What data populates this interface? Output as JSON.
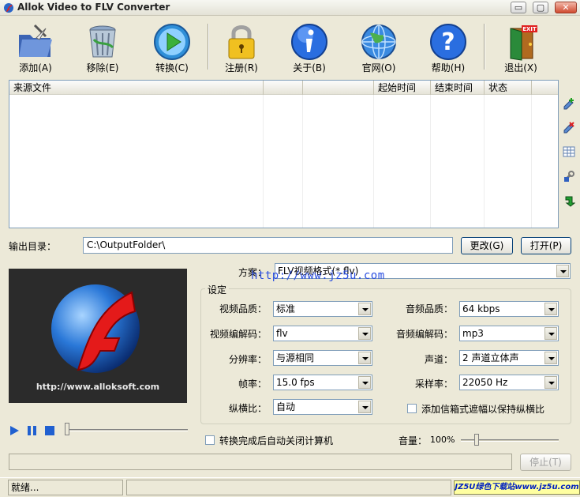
{
  "window": {
    "title": "Allok Video to FLV Converter",
    "min": "▭",
    "max": "▢",
    "close": "✕"
  },
  "toolbar": [
    {
      "label": "添加(A)",
      "icon": "folder-add-icon"
    },
    {
      "label": "移除(E)",
      "icon": "trash-bin-icon"
    },
    {
      "label": "转换(C)",
      "icon": "play-convert-icon"
    },
    {
      "label": "注册(R)",
      "icon": "padlock-icon"
    },
    {
      "label": "关于(B)",
      "icon": "info-icon"
    },
    {
      "label": "官网(O)",
      "icon": "globe-icon"
    },
    {
      "label": "帮助(H)",
      "icon": "help-icon"
    },
    {
      "label": "退出(X)",
      "icon": "exit-door-icon"
    }
  ],
  "filelist": {
    "columns": [
      "来源文件",
      "",
      "",
      "起始时间",
      "结束时间",
      "状态"
    ]
  },
  "output": {
    "label": "输出目录：",
    "path": "C:\\OutputFolder\\",
    "change_label": "更改(G)",
    "open_label": "打开(P)"
  },
  "preview": {
    "url_text": "http://www.alloksoft.com"
  },
  "profile": {
    "label": "方案：",
    "value": "FLV视频格式(*.flv)"
  },
  "watermark": "http://www.jz5u.com",
  "settings": {
    "group_title": "设定",
    "video_quality_label": "视频品质：",
    "video_quality": "标准",
    "video_codec_label": "视频编解码：",
    "video_codec": "flv",
    "resolution_label": "分辨率：",
    "resolution": "与源相同",
    "framerate_label": "帧率：",
    "framerate": "15.0   fps",
    "aspect_label": "纵横比：",
    "aspect": "自动",
    "audio_quality_label": "音频品质：",
    "audio_quality": "64  kbps",
    "audio_codec_label": "音频编解码：",
    "audio_codec": "mp3",
    "channels_label": "声道：",
    "channels": "2 声道立体声",
    "samplerate_label": "采样率：",
    "samplerate": "22050 Hz",
    "letterbox_label": "添加信箱式遮幅以保持纵横比"
  },
  "shutdown_label": "转换完成后自动关闭计算机",
  "volume": {
    "label": "音量：",
    "value": "100%"
  },
  "stop_label": "停止(T)",
  "status": {
    "text": "就绪...",
    "badge": "JZ5U绿色下载站www.jz5u.com"
  },
  "colors": {
    "bg": "#ece9d8",
    "border": "#7f9db9",
    "watermark": "#2b4fe0"
  }
}
